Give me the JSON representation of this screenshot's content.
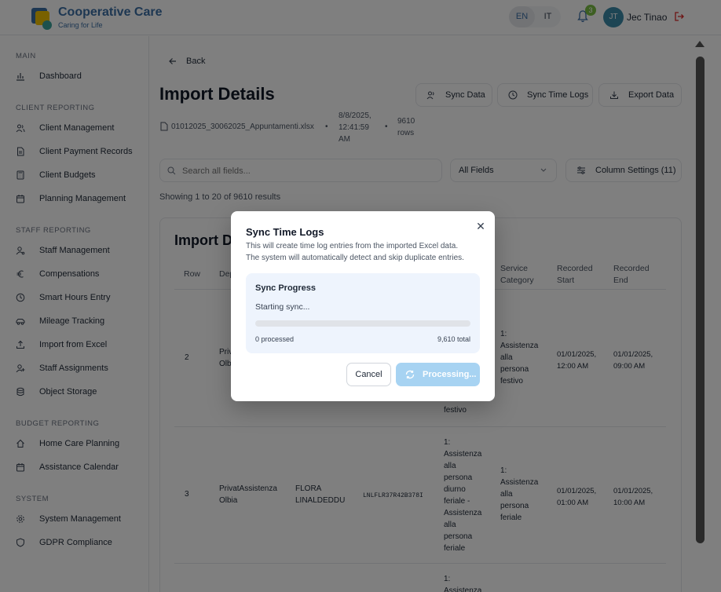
{
  "header": {
    "brand_title": "Cooperative Care",
    "brand_subtitle": "Caring for Life",
    "lang_en": "EN",
    "lang_it": "IT",
    "notification_count": "3",
    "avatar_initials": "JT",
    "user_name": "Jec Tinao"
  },
  "sidebar": {
    "sections": {
      "main": "MAIN",
      "client": "CLIENT REPORTING",
      "staff": "STAFF REPORTING",
      "budget": "BUDGET REPORTING",
      "system": "SYSTEM"
    },
    "items": {
      "dashboard": "Dashboard",
      "client_management": "Client Management",
      "client_payment_records": "Client Payment Records",
      "client_budgets": "Client Budgets",
      "planning_management": "Planning Management",
      "staff_management": "Staff Management",
      "compensations": "Compensations",
      "smart_hours_entry": "Smart Hours Entry",
      "mileage_tracking": "Mileage Tracking",
      "import_from_excel": "Import from Excel",
      "staff_assignments": "Staff Assignments",
      "object_storage": "Object Storage",
      "home_care_planning": "Home Care Planning",
      "assistance_calendar": "Assistance Calendar",
      "system_management": "System Management",
      "gdpr_compliance": "GDPR Compliance"
    }
  },
  "main": {
    "back_label": "Back",
    "title": "Import Details",
    "sync_data_label": "Sync Data",
    "sync_time_logs_label": "Sync Time Logs",
    "export_data_label": "Export Data",
    "file_name": "01012025_30062025_Appuntamenti.xlsx",
    "import_date": "8/8/2025,",
    "import_time": "12:41:59",
    "import_ampm": "AM",
    "rows_count": "9610",
    "rows_label": "rows",
    "search_placeholder": "Search all fields...",
    "field_filter": "All Fields",
    "column_settings": "Column Settings (11)",
    "showing": "Showing 1 to 20 of 9610 results",
    "card_title": "Import Details",
    "headers": {
      "row": "Row",
      "department": "Department",
      "service_category_1": "Service",
      "service_category_2": "Category",
      "recorded_start_1": "Recorded",
      "recorded_start_2": "Start",
      "recorded_end_1": "Recorded",
      "recorded_end_2": "End"
    },
    "rows": [
      {
        "row": "2",
        "dept_1": "Privat",
        "dept_2": "Olbia",
        "service_trail": "festivo",
        "category": [
          "1:",
          "Assistenza",
          "alla",
          "persona",
          "festivo"
        ],
        "start_1": "01/01/2025,",
        "start_2": "12:00 AM",
        "end_1": "01/01/2025,",
        "end_2": "09:00 AM"
      },
      {
        "row": "3",
        "dept_1": "PrivatAssistenza",
        "dept_2": "Olbia",
        "name_1": "FLORA",
        "name_2": "LINALDEDDU",
        "code": "LNLFLR37R42B378I",
        "service": [
          "1:",
          "Assistenza",
          "alla",
          "persona",
          "diurno",
          "feriale -",
          "Assistenza",
          "alla",
          "persona",
          "feriale"
        ],
        "category": [
          "1:",
          "Assistenza",
          "alla",
          "persona",
          "feriale"
        ],
        "start_1": "01/01/2025,",
        "start_2": "01:00 AM",
        "end_1": "01/01/2025,",
        "end_2": "10:00 AM"
      }
    ],
    "row4_service": [
      "1:",
      "Assistenza"
    ]
  },
  "modal": {
    "title": "Sync Time Logs",
    "desc_1": "This will create time log entries from the imported Excel data.",
    "desc_2": "The system will automatically detect and skip duplicate entries.",
    "progress_title": "Sync Progress",
    "progress_status": "Starting sync...",
    "progress_value": 0,
    "processed": "0 processed",
    "total": "9,610 total",
    "cancel_label": "Cancel",
    "processing_label": "Processing..."
  },
  "colors": {
    "brand": "#3b6ea5",
    "badge": "#7bbf44",
    "progress_bg": "#eef4fd",
    "processing_button": "#a7d3f2"
  }
}
